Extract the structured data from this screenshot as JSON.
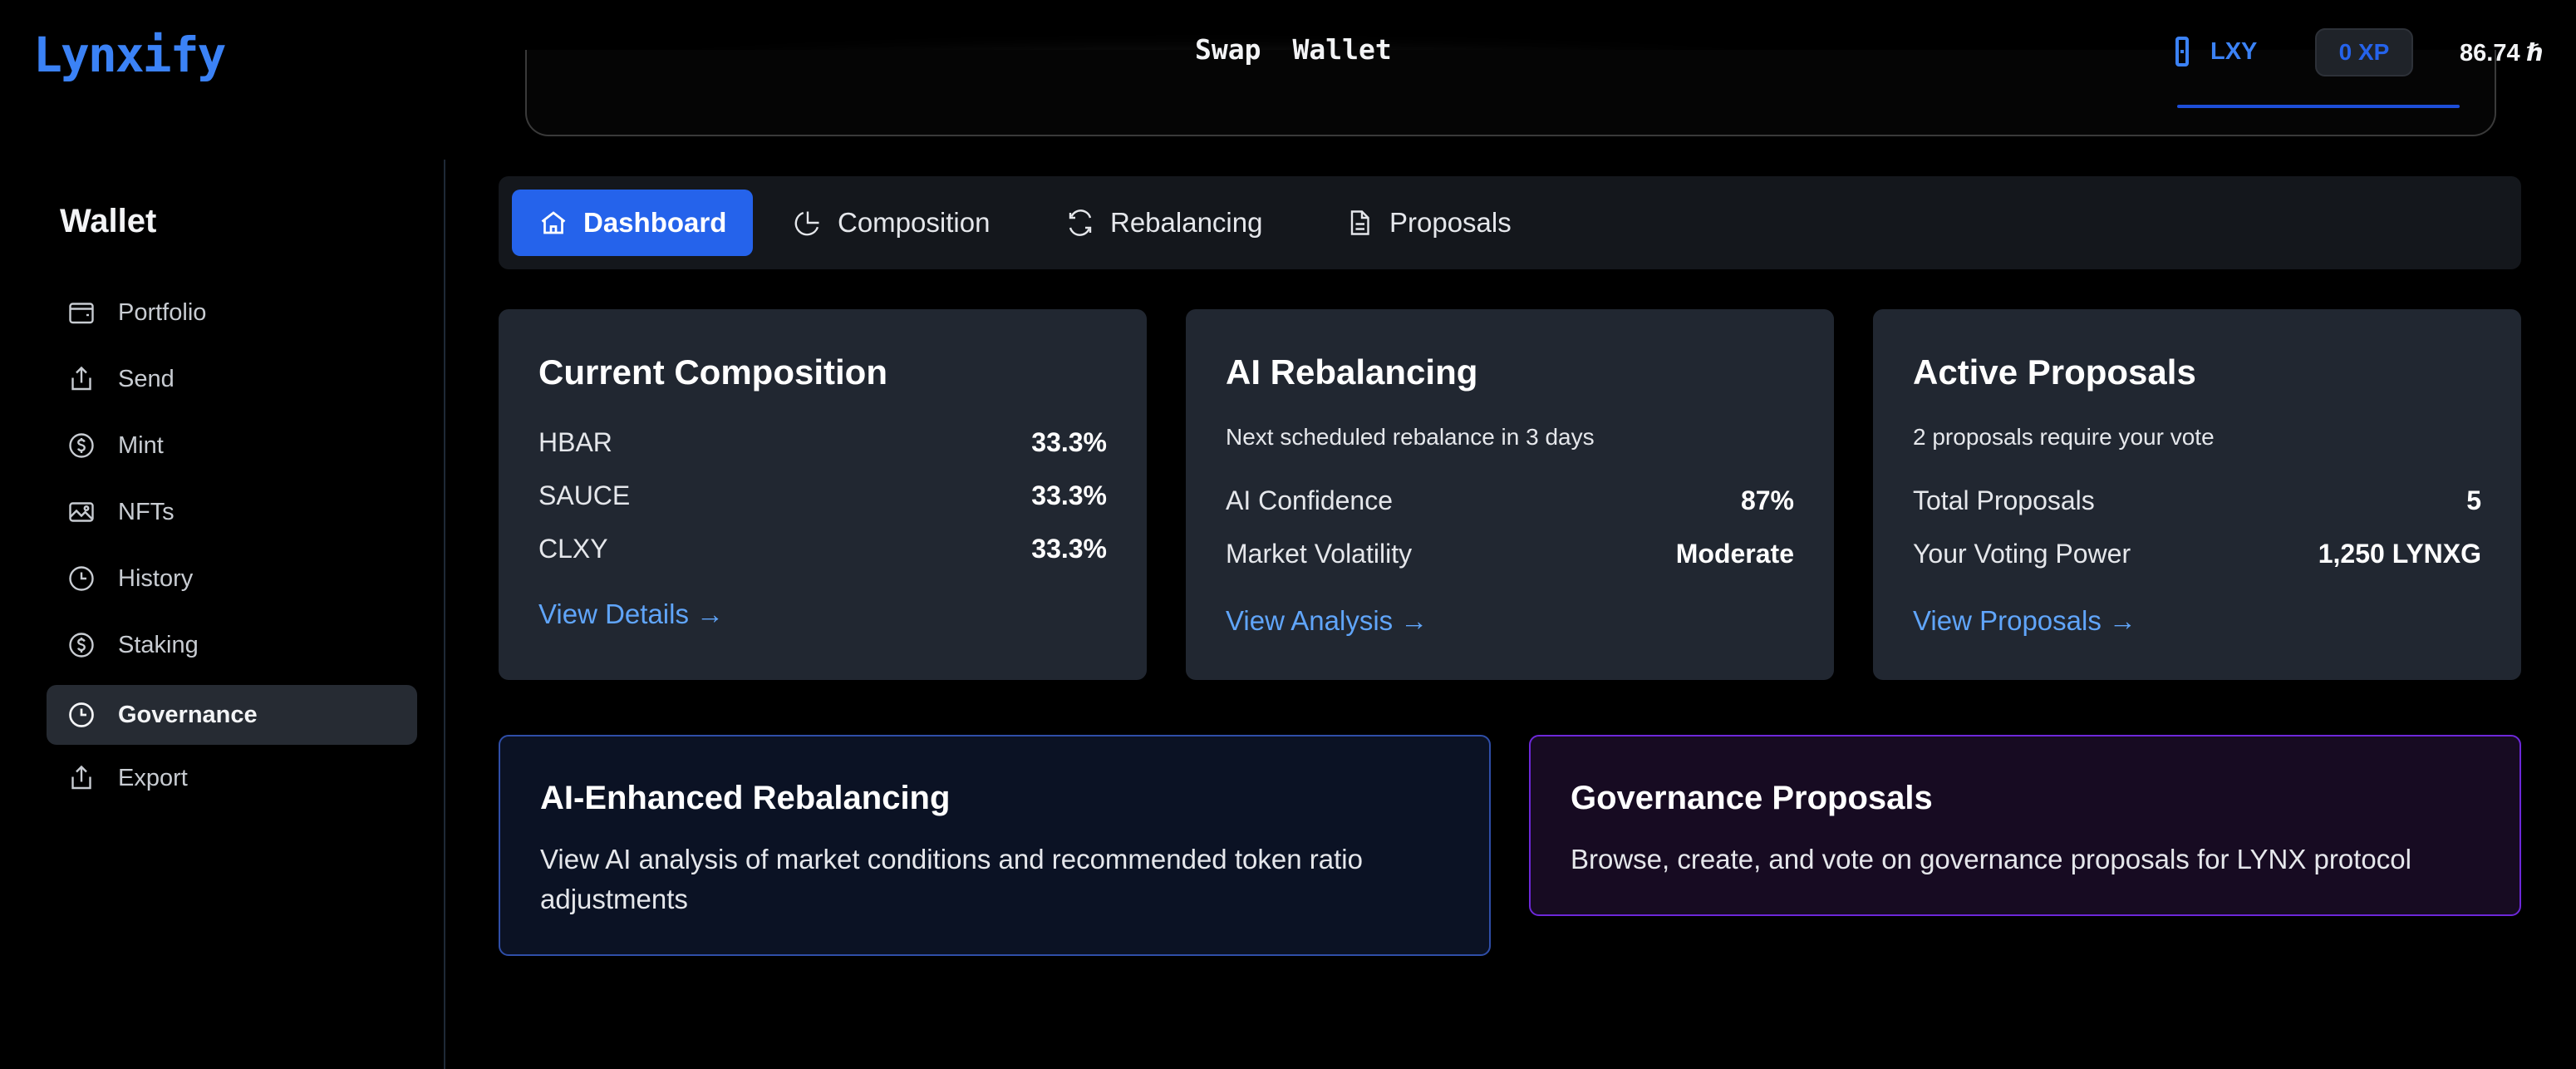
{
  "header": {
    "logo": "Lynxify",
    "nav": [
      "Swap",
      "Wallet"
    ],
    "token_label": "LXY",
    "xp": "0 XP",
    "balance": "86.74 ℏ"
  },
  "sidebar": {
    "title": "Wallet",
    "items": [
      {
        "label": "Portfolio",
        "icon": "wallet-icon"
      },
      {
        "label": "Send",
        "icon": "share-icon"
      },
      {
        "label": "Mint",
        "icon": "dollar-icon"
      },
      {
        "label": "NFTs",
        "icon": "image-icon"
      },
      {
        "label": "History",
        "icon": "clock-icon"
      },
      {
        "label": "Staking",
        "icon": "dollar-icon"
      },
      {
        "label": "Governance",
        "icon": "clock-icon",
        "active": true
      },
      {
        "label": "Export",
        "icon": "share-icon"
      }
    ]
  },
  "tabs": [
    {
      "label": "Dashboard",
      "icon": "home-icon",
      "active": true
    },
    {
      "label": "Composition",
      "icon": "pie-chart-icon"
    },
    {
      "label": "Rebalancing",
      "icon": "refresh-icon"
    },
    {
      "label": "Proposals",
      "icon": "document-icon"
    }
  ],
  "cards": {
    "composition": {
      "title": "Current Composition",
      "rows": [
        {
          "label": "HBAR",
          "value": "33.3%"
        },
        {
          "label": "SAUCE",
          "value": "33.3%"
        },
        {
          "label": "CLXY",
          "value": "33.3%"
        }
      ],
      "link": "View Details →"
    },
    "rebalancing": {
      "title": "AI Rebalancing",
      "subtitle": "Next scheduled rebalance in 3 days",
      "rows": [
        {
          "label": "AI Confidence",
          "value": "87%"
        },
        {
          "label": "Market Volatility",
          "value": "Moderate"
        }
      ],
      "link": "View Analysis →"
    },
    "proposals": {
      "title": "Active Proposals",
      "subtitle": "2 proposals require your vote",
      "rows": [
        {
          "label": "Total Proposals",
          "value": "5"
        },
        {
          "label": "Your Voting Power",
          "value": "1,250 LYNXG"
        }
      ],
      "link": "View Proposals →"
    }
  },
  "features": {
    "ai": {
      "title": "AI-Enhanced Rebalancing",
      "description": "View AI analysis of market conditions and recommended token ratio adjustments"
    },
    "governance": {
      "title": "Governance Proposals",
      "description": "Browse, create, and vote on governance proposals for LYNX protocol"
    }
  },
  "colors": {
    "accent": "#2563eb",
    "link": "#60a5fa",
    "card_bg": "#212731",
    "ai_border": "#3b5bdb",
    "governance_border": "#7c3aed"
  }
}
